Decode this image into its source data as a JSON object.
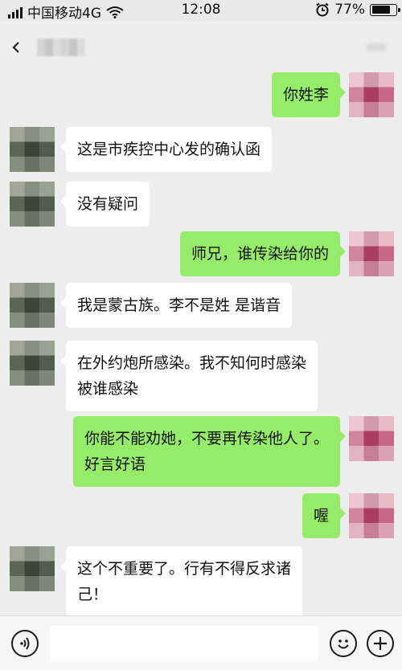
{
  "status_bar": {
    "carrier": "中国移动4G",
    "time": "12:08",
    "battery": "77%",
    "battery_level": 0.77
  },
  "nav": {
    "back_icon": "chevron-left-icon"
  },
  "messages": [
    {
      "side": "out",
      "text": "你姓李"
    },
    {
      "side": "in",
      "text": "这是市疾控中心发的确认函"
    },
    {
      "side": "in",
      "text": "没有疑问"
    },
    {
      "side": "out",
      "text": "师兄，谁传染给你的"
    },
    {
      "side": "in",
      "text": "我是蒙古族。李不是姓 是谐音"
    },
    {
      "side": "in",
      "lines": [
        "在外约炮所感染。我不知何时感染",
        "被谁感染"
      ]
    },
    {
      "side": "out",
      "lines": [
        "你能不能劝她，不要再传染他人了。",
        "好言好语"
      ]
    },
    {
      "side": "out",
      "text": "喔"
    },
    {
      "side": "in",
      "lines": [
        "这个不重要了。行有不得反求诸",
        "己！"
      ]
    }
  ],
  "input_bar": {
    "voice_icon": "voice-icon",
    "emoji_icon": "emoji-icon",
    "plus_icon": "plus-icon",
    "input_value": ""
  },
  "colors": {
    "outgoing_bubble": "#95ec69",
    "incoming_bubble": "#ffffff",
    "background": "#ededed"
  }
}
